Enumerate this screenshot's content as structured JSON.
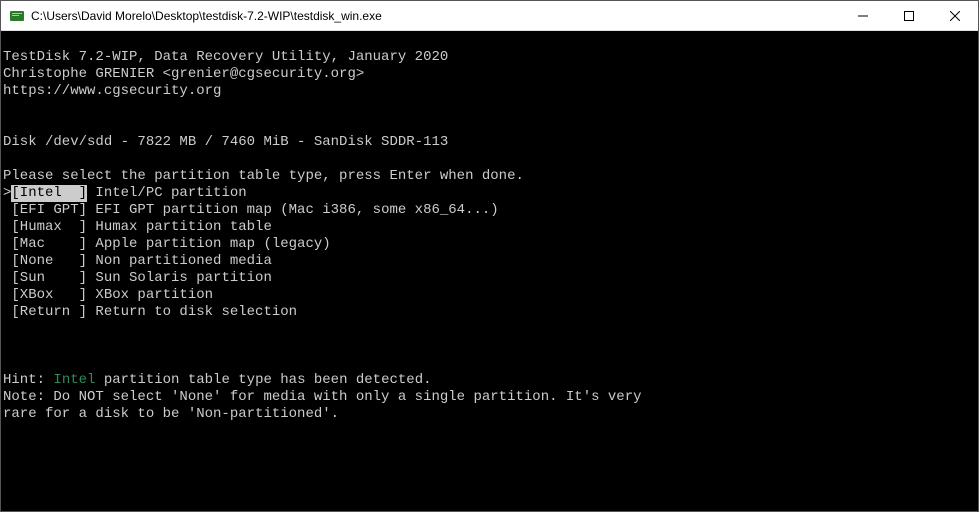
{
  "titlebar": {
    "title": "C:\\Users\\David Morelo\\Desktop\\testdisk-7.2-WIP\\testdisk_win.exe"
  },
  "header": {
    "line1": "TestDisk 7.2-WIP, Data Recovery Utility, January 2020",
    "line2": "Christophe GRENIER <grenier@cgsecurity.org>",
    "line3": "https://www.cgsecurity.org"
  },
  "disk_line": "Disk /dev/sdd - 7822 MB / 7460 MiB - SanDisk SDDR-113",
  "prompt": "Please select the partition table type, press Enter when done.",
  "menu": [
    {
      "key": "[Intel  ]",
      "desc": "Intel/PC partition",
      "selected": true
    },
    {
      "key": "[EFI GPT]",
      "desc": "EFI GPT partition map (Mac i386, some x86_64...)",
      "selected": false
    },
    {
      "key": "[Humax  ]",
      "desc": "Humax partition table",
      "selected": false
    },
    {
      "key": "[Mac    ]",
      "desc": "Apple partition map (legacy)",
      "selected": false
    },
    {
      "key": "[None   ]",
      "desc": "Non partitioned media",
      "selected": false
    },
    {
      "key": "[Sun    ]",
      "desc": "Sun Solaris partition",
      "selected": false
    },
    {
      "key": "[XBox   ]",
      "desc": "XBox partition",
      "selected": false
    },
    {
      "key": "[Return ]",
      "desc": "Return to disk selection",
      "selected": false
    }
  ],
  "hint": {
    "prefix": "Hint: ",
    "highlight": "Intel",
    "suffix": " partition table type has been detected."
  },
  "note": {
    "line1": "Note: Do NOT select 'None' for media with only a single partition. It's very",
    "line2": "rare for a disk to be 'Non-partitioned'."
  }
}
